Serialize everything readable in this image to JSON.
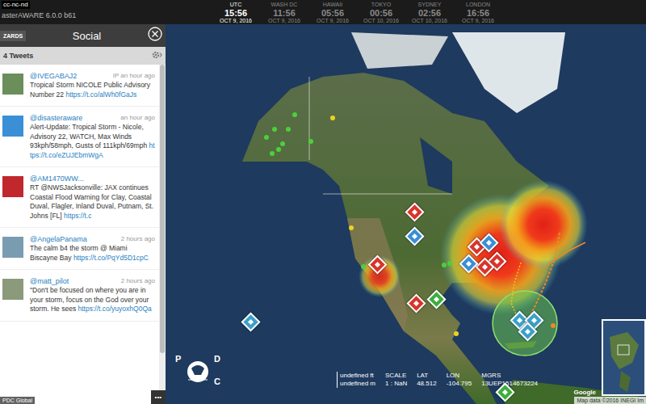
{
  "app": {
    "license": "cc-nc-nd",
    "title": "asterAWARE 6.0.0 b61"
  },
  "clocks": [
    {
      "city": "UTC",
      "time": "15:56",
      "date": "OCT 9, 2016",
      "selected": true
    },
    {
      "city": "WASH DC",
      "time": "11:56",
      "date": "OCT 9, 2016",
      "selected": false
    },
    {
      "city": "HAWAII",
      "time": "05:56",
      "date": "OCT 9, 2016",
      "selected": false
    },
    {
      "city": "TOKYO",
      "time": "00:56",
      "date": "OCT 10, 2016",
      "selected": false
    },
    {
      "city": "SYDNEY",
      "time": "02:56",
      "date": "OCT 10, 2016",
      "selected": false
    },
    {
      "city": "LONDON",
      "time": "16:56",
      "date": "OCT 9, 2016",
      "selected": false
    }
  ],
  "panel": {
    "wizards_button": "ZARDS",
    "title": "Social",
    "count": "4 Tweets",
    "more": "•••",
    "watermark": "PDC Global",
    "scroll": {
      "level": 0.85
    }
  },
  "tweets": [
    {
      "name": "@IVEGABAJ2",
      "time": "IP an hour ago",
      "text": "Tropical Storm NICOLE Public Advisory Number 22 ",
      "link": "https://t.co/alWh0fGaJs",
      "color": "#6a8f5a"
    },
    {
      "name": "@disasteraware",
      "time": "an hour ago",
      "text": "Alert-Update: Tropical Storm - Nicole, Advisory 22, WATCH, Max Winds 93kph/58mph, Gusts of 111kph/69mph ",
      "link": "https://t.co/eZUJEbmWgA",
      "color": "#3a8fd6"
    },
    {
      "name": "@AM1470WW...",
      "text": "RT @NWSJacksonville: JAX continues Coastal Flood Warning for Clay, Coastal Duval, Flagler, Inland Duval, Putnam, St. Johns [FL] ",
      "link": "https://t.c",
      "color": "#c0282d"
    },
    {
      "name": "@AngelaPanama",
      "time": "2 hours ago",
      "text": "The calm b4 the storm @ Miami Biscayne Bay ",
      "link": "https://t.co/PqYd5D1cpC",
      "color": "#7a9cb0"
    },
    {
      "name": "@matt_pilot",
      "time": "2 hours ago",
      "text": "\"Don't be focused on where you are in your storm, focus on the God over your storm. He sees ",
      "link": "https://t.co/yuyoxhQ0Qa",
      "color": "#8a9a7a"
    }
  ],
  "map": {
    "markers": [
      {
        "kind": "hazard",
        "color": "#d9342b"
      },
      {
        "kind": "hazard",
        "color": "#d9342b"
      },
      {
        "kind": "hazard",
        "color": "#d9342b"
      },
      {
        "kind": "hazard",
        "color": "#d9342b"
      },
      {
        "kind": "hazard",
        "color": "#d9342b"
      },
      {
        "kind": "hazard",
        "color": "#d9342b"
      },
      {
        "kind": "hazard",
        "color": "#3a8fd6"
      },
      {
        "kind": "hazard",
        "color": "#3a8fd6"
      },
      {
        "kind": "hazard",
        "color": "#3a8fd6"
      },
      {
        "kind": "hazard",
        "color": "#3aa0c8"
      },
      {
        "kind": "hazard",
        "color": "#3cae3c"
      },
      {
        "kind": "hazard",
        "color": "#3aa0c8"
      },
      {
        "kind": "hazard",
        "color": "#3aa0c8"
      },
      {
        "kind": "hazard",
        "color": "#3aa0c8"
      },
      {
        "kind": "hazard",
        "color": "#3cae3c"
      },
      {
        "kind": "dot",
        "color": "#4cd03c"
      },
      {
        "kind": "dot",
        "color": "#4cd03c"
      },
      {
        "kind": "dot",
        "color": "#4cd03c"
      },
      {
        "kind": "dot",
        "color": "#4cd03c"
      },
      {
        "kind": "dot",
        "color": "#4cd03c"
      },
      {
        "kind": "dot",
        "color": "#4cd03c"
      },
      {
        "kind": "dot",
        "color": "#4cd03c"
      },
      {
        "kind": "dot",
        "color": "#4cd03c"
      },
      {
        "kind": "dot",
        "color": "#4cd03c"
      },
      {
        "kind": "dot",
        "color": "#4cd03c"
      },
      {
        "kind": "dot",
        "color": "#4cd03c"
      },
      {
        "kind": "dot",
        "color": "#f0d21e"
      },
      {
        "kind": "dot",
        "color": "#f0d21e"
      },
      {
        "kind": "dot",
        "color": "#f0d21e"
      },
      {
        "kind": "dot",
        "color": "#f08a1e"
      }
    ],
    "scale": {
      "feet": "undefined ft",
      "meters": "undefined m",
      "scale_label": "SCALE",
      "scale": "1 : NaN",
      "lat_label": "LAT",
      "lat": "48.512",
      "lon_label": "LON",
      "lon": "-104.795",
      "mgrs_label": "MGRS",
      "mgrs": "13UEP1514673224"
    },
    "logo": [
      "P",
      "D",
      "C"
    ],
    "google": "Google",
    "attribution": "Map data ©2016 INEGI Im"
  }
}
